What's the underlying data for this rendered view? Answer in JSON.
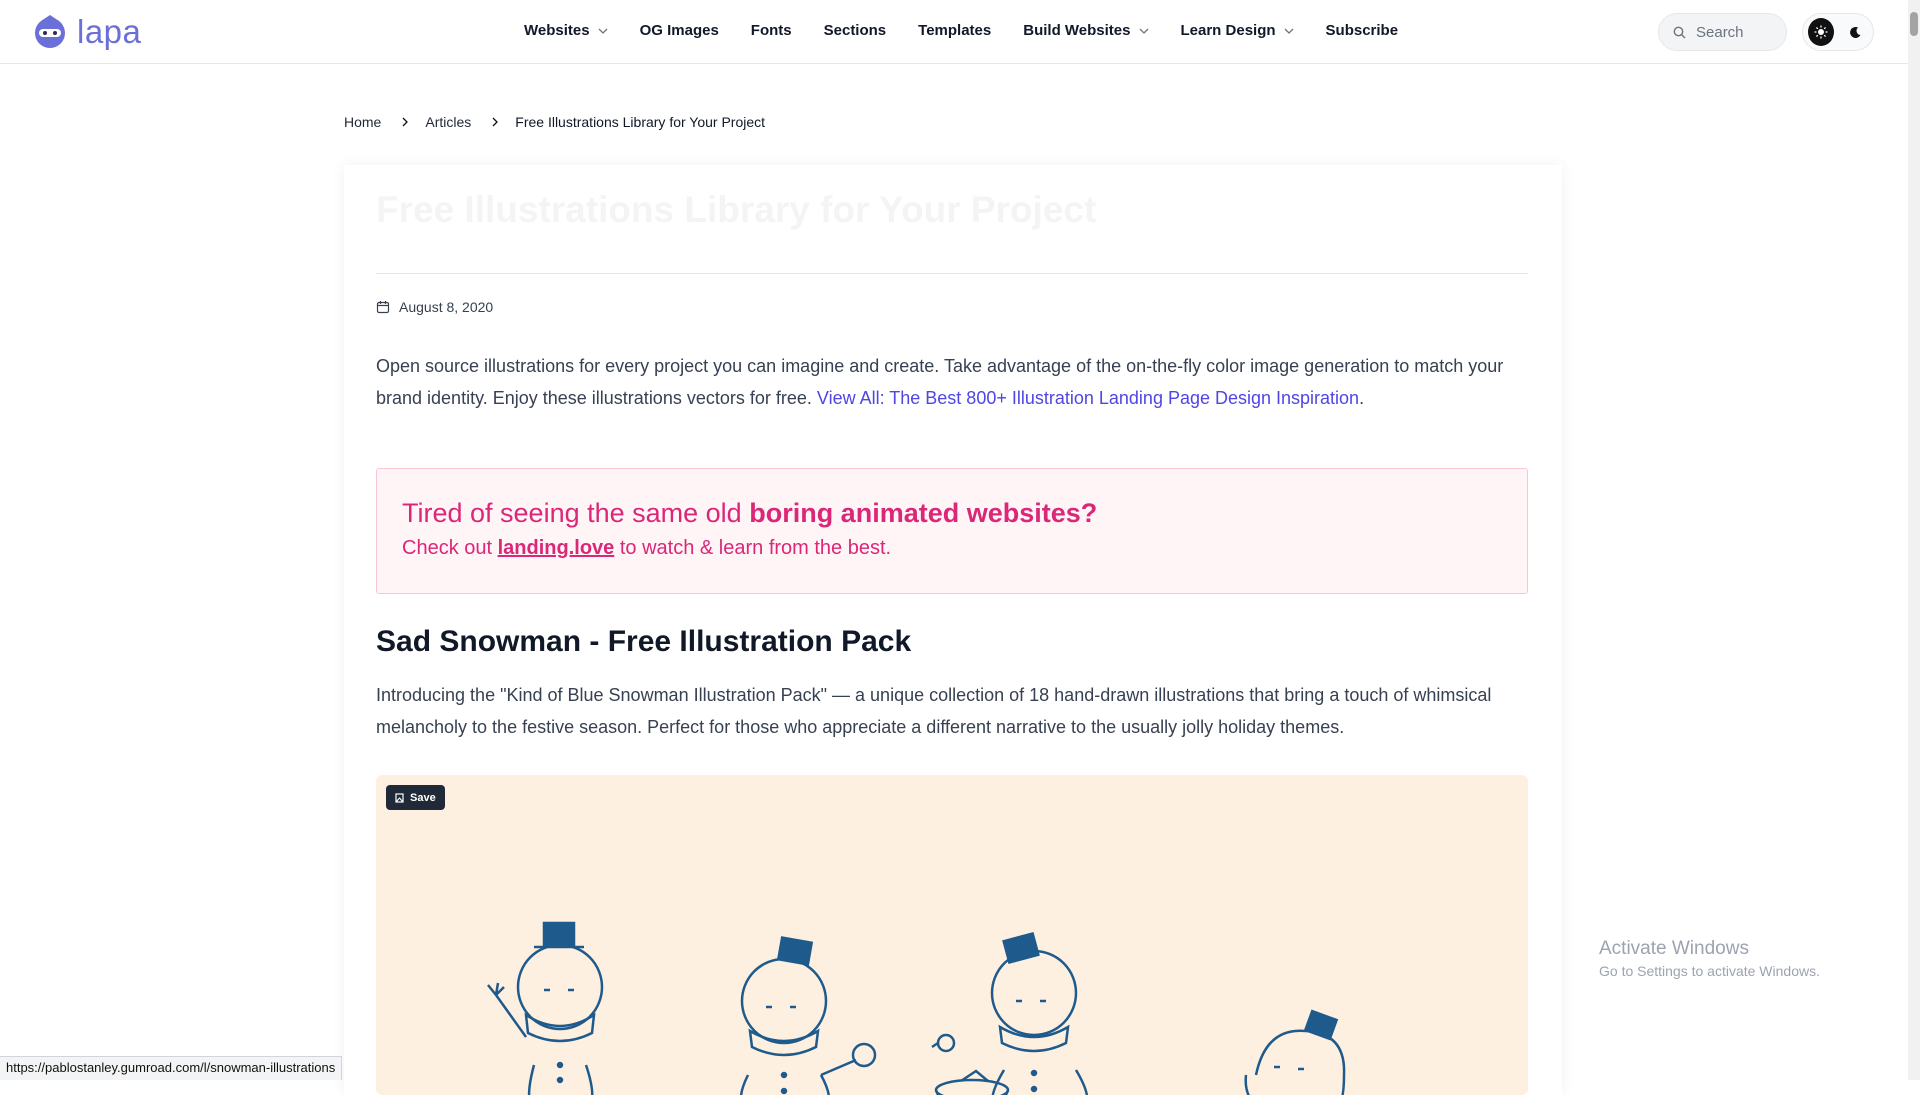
{
  "brand": {
    "name": "lapa"
  },
  "nav": [
    {
      "label": "Websites",
      "dropdown": true
    },
    {
      "label": "OG Images",
      "dropdown": false
    },
    {
      "label": "Fonts",
      "dropdown": false
    },
    {
      "label": "Sections",
      "dropdown": false
    },
    {
      "label": "Templates",
      "dropdown": false
    },
    {
      "label": "Build Websites",
      "dropdown": true
    },
    {
      "label": "Learn Design",
      "dropdown": true
    },
    {
      "label": "Subscribe",
      "dropdown": false
    }
  ],
  "search": {
    "placeholder": "Search"
  },
  "breadcrumb": {
    "home": "Home",
    "articles": "Articles",
    "current": "Free Illustrations Library for Your Project"
  },
  "article": {
    "title": "Free Illustrations Library for Your Project",
    "date": "August 8, 2020",
    "intro": "Open source illustrations for every project you can imagine and create. Take advantage of the on-the-fly color image generation to match your brand identity. Enjoy these illustrations vectors for free. ",
    "intro_link": "View All: The Best 800+ Illustration Landing Page Design Inspiration",
    "intro_end": ".",
    "promo": {
      "line1_a": "Tired of seeing the same old ",
      "line1_b": "boring animated websites?",
      "line2_a": "Check out ",
      "line2_link": "landing.love",
      "line2_b": " to watch & learn from the best."
    },
    "section_title": "Sad Snowman - Free Illustration Pack",
    "section_desc": "Introducing the \"Kind of Blue Snowman Illustration Pack\" — a unique collection of 18 hand-drawn illustrations that bring a touch of whimsical melancholy to the festive season. Perfect for those who appreciate a different narrative to the usually jolly holiday themes.",
    "save_label": "Save"
  },
  "status_url": "https://pablostanley.gumroad.com/l/snowman-illustrations",
  "watermark": {
    "line1": "Activate Windows",
    "line2": "Go to Settings to activate Windows."
  },
  "colors": {
    "accent": "#4f46e5",
    "promo": "#db2777",
    "illustration_bg": "#fdf0e1",
    "snowman": "#1e5a8c"
  }
}
